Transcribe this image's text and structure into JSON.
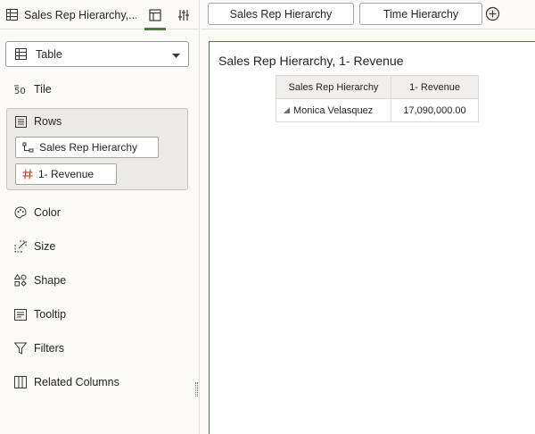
{
  "left_panel": {
    "viz_tab_title": "Sales Rep Hierarchy,...",
    "viz_type": "Table",
    "grammar": {
      "tile": "Tile",
      "rows": "Rows",
      "row_items": [
        "Sales Rep Hierarchy",
        "1- Revenue"
      ],
      "color": "Color",
      "size": "Size",
      "shape": "Shape",
      "tooltip": "Tooltip",
      "filters": "Filters",
      "related_columns": "Related Columns"
    }
  },
  "tabs": [
    "Sales Rep Hierarchy",
    "Time Hierarchy"
  ],
  "canvas": {
    "title": "Sales Rep Hierarchy, 1- Revenue",
    "table": {
      "headers": [
        "Sales Rep Hierarchy",
        "1- Revenue"
      ],
      "rows": [
        {
          "member": "Monica Velasquez",
          "revenue": "17,090,000.00"
        }
      ]
    }
  },
  "colors": {
    "accent_green": "#4e7d43",
    "number_icon": "#c74634"
  }
}
